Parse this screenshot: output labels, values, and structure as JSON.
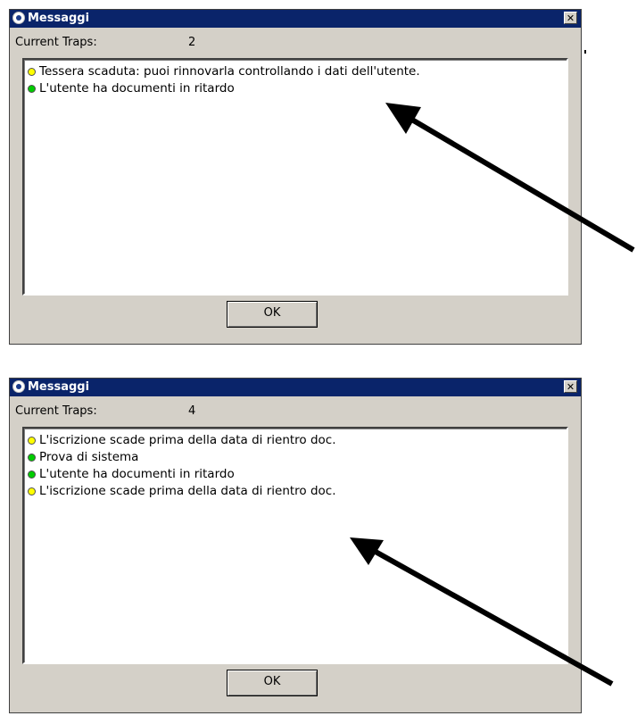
{
  "dialogs": [
    {
      "title": "Messaggi",
      "close_glyph": "✕",
      "traps_label": "Current Traps:",
      "traps_count": "2",
      "messages": [
        {
          "icon": "yellow-dot-icon",
          "color": "#ffff00",
          "text": "Tessera scaduta: puoi rinnovarla controllando i dati dell'utente."
        },
        {
          "icon": "green-dot-icon",
          "color": "#00cc00",
          "text": "L'utente ha documenti in ritardo"
        }
      ],
      "ok_label": "OK"
    },
    {
      "title": "Messaggi",
      "close_glyph": "✕",
      "traps_label": "Current Traps:",
      "traps_count": "4",
      "messages": [
        {
          "icon": "yellow-dot-icon",
          "color": "#ffff00",
          "text": "L'iscrizione scade prima della data di rientro doc."
        },
        {
          "icon": "green-dot-icon",
          "color": "#00cc00",
          "text": "Prova di sistema"
        },
        {
          "icon": "green-dot-icon",
          "color": "#00cc00",
          "text": "L'utente ha documenti in ritardo"
        },
        {
          "icon": "yellow-dot-icon",
          "color": "#ffff00",
          "text": "L'iscrizione scade prima della data di rientro doc."
        }
      ],
      "ok_label": "OK"
    }
  ],
  "colors": {
    "titlebar": "#0a246a",
    "dialog_bg": "#d4d0c8",
    "arrow": "#000000"
  },
  "annotations": [
    {
      "icon": "pointer-arrow-icon",
      "points_to": "first message in upper dialog"
    },
    {
      "icon": "pointer-arrow-icon",
      "points_to": "last message in lower dialog"
    }
  ]
}
